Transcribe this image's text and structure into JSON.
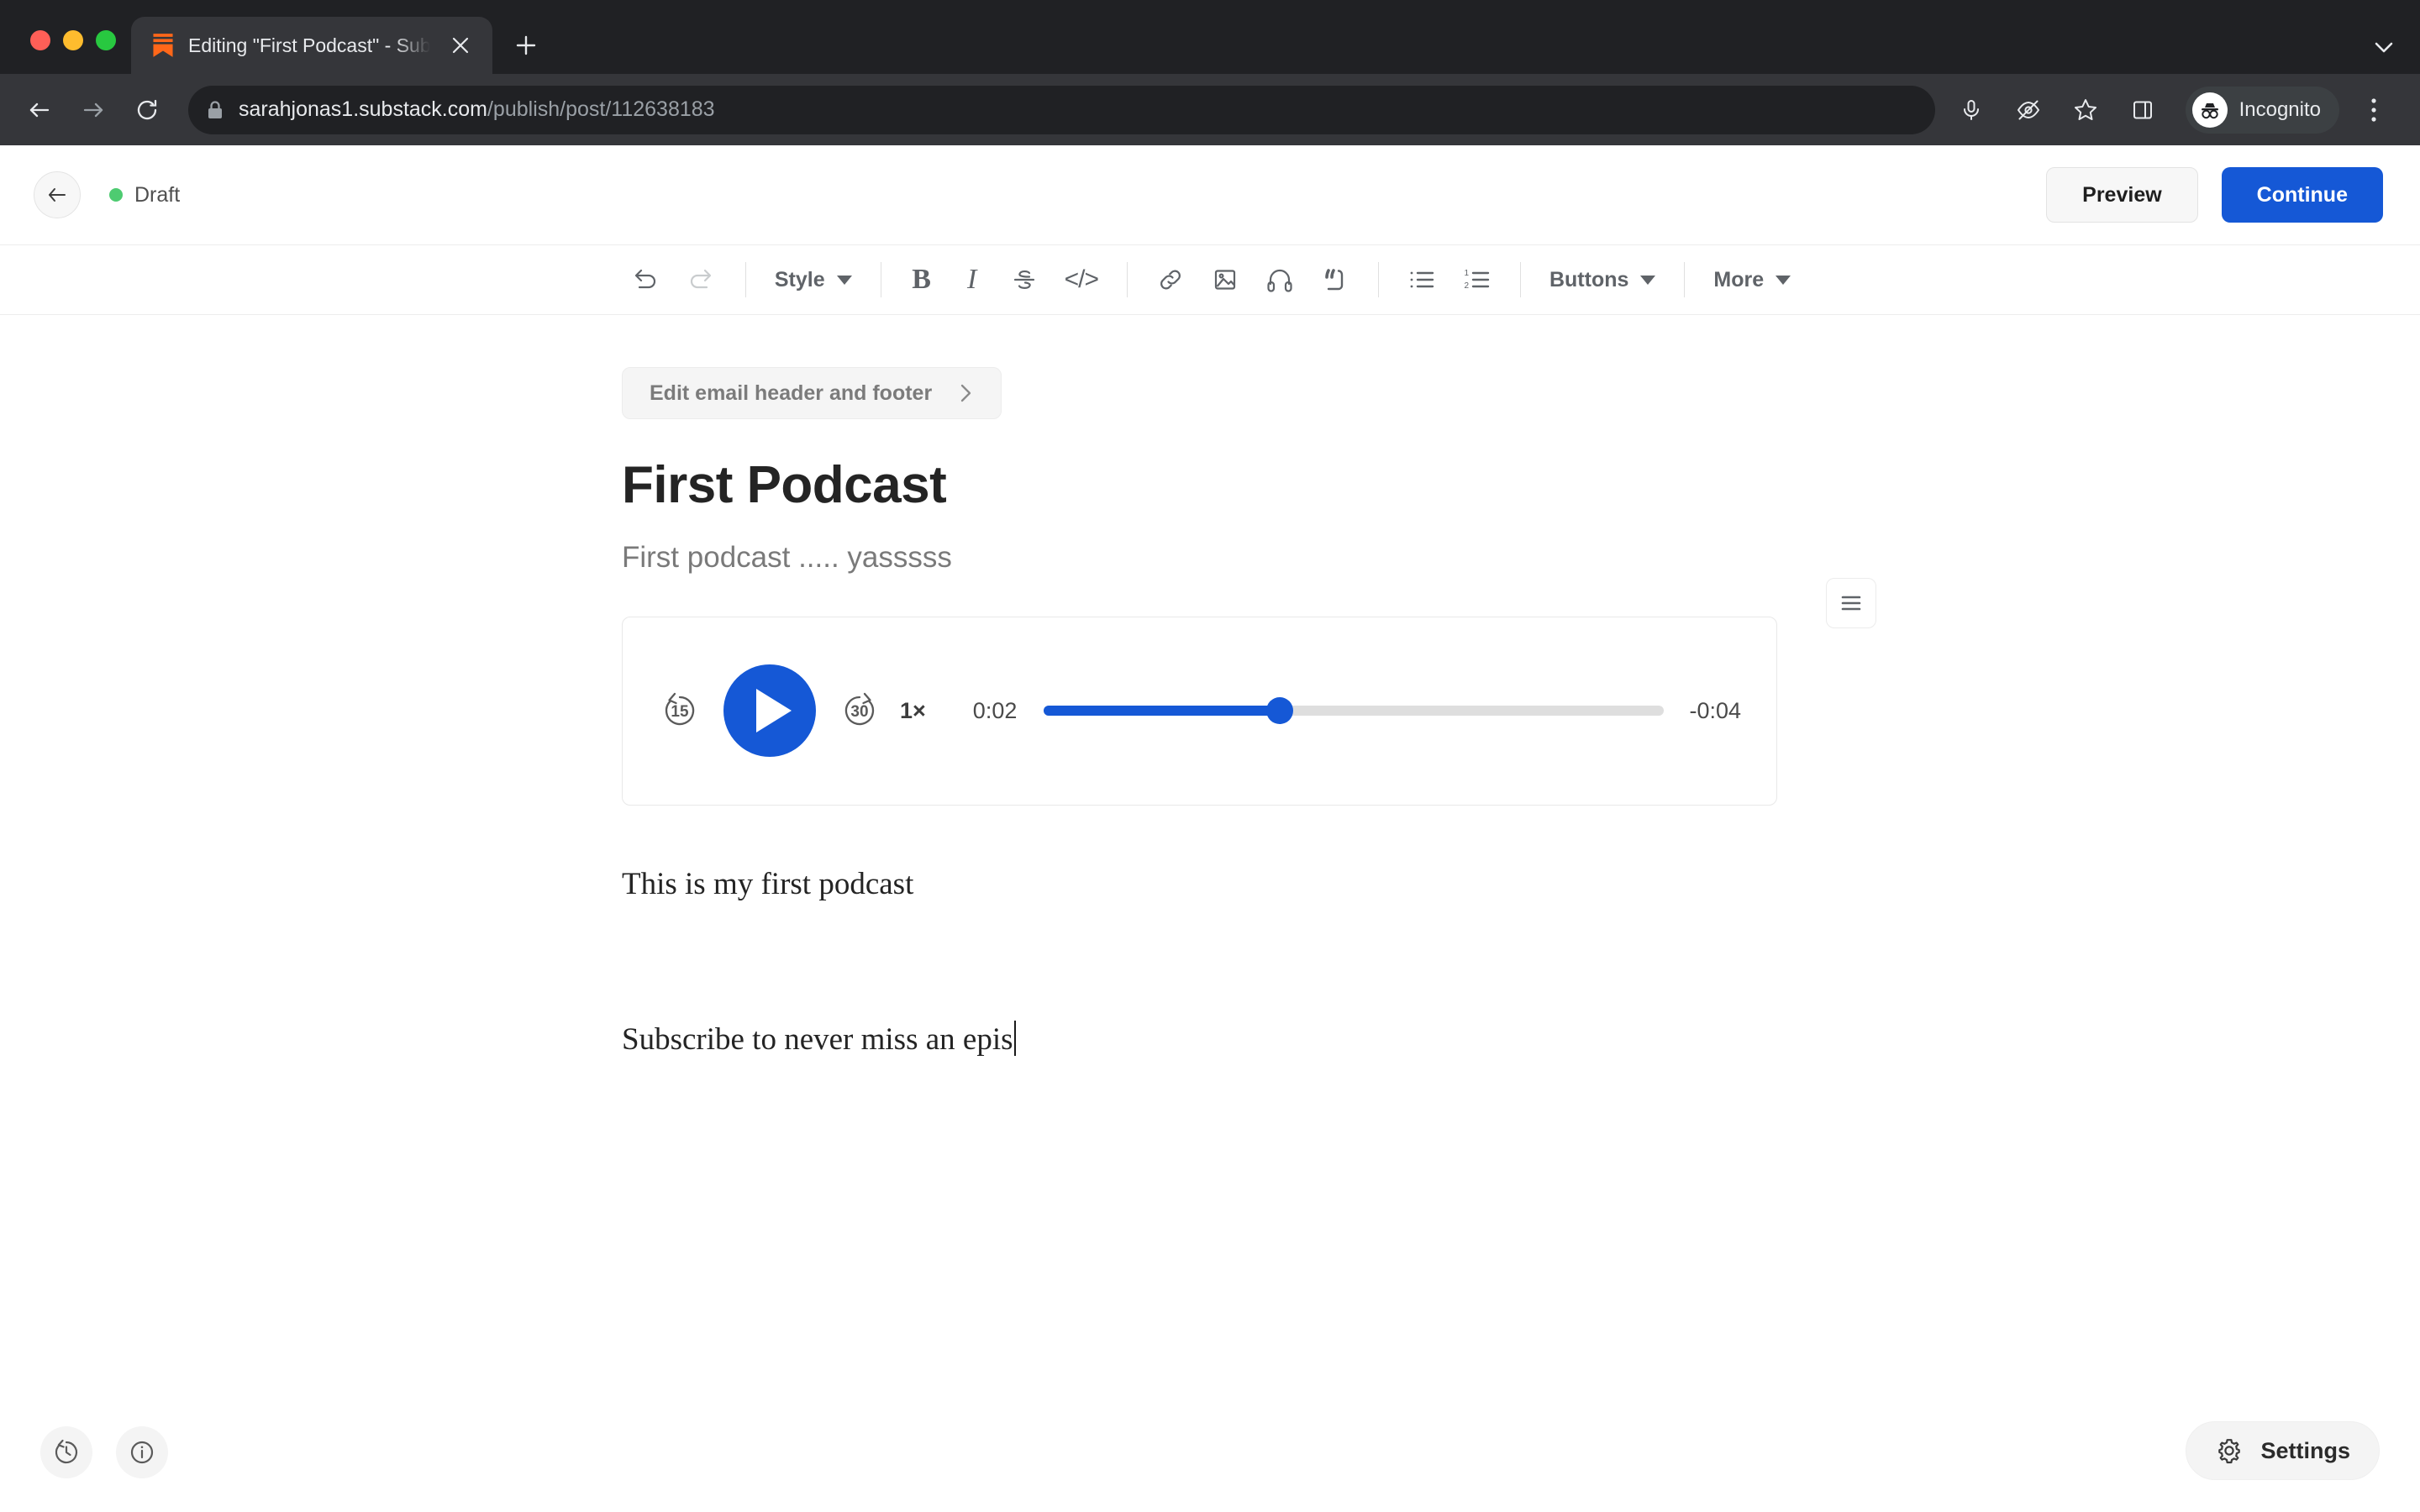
{
  "browser": {
    "tab": {
      "title": "Editing \"First Podcast\" - Subst",
      "favicon": "substack-icon",
      "close": "close-icon",
      "newtab": "new-tab-icon"
    },
    "toolbar": {
      "back": "back-arrow-icon",
      "forward": "forward-arrow-icon",
      "reload": "reload-icon",
      "lock": "lock-icon",
      "url_domain": "sarahjonas1.substack.com",
      "url_path": "/publish/post/112638183",
      "mic": "microphone-icon",
      "eye_off": "eye-off-icon",
      "bookmark": "star-icon",
      "side_panel": "side-panel-icon",
      "profile_label": "Incognito",
      "menu": "three-dots-icon",
      "tabstrip_chevron": "chevron-down-icon"
    }
  },
  "app_header": {
    "back": "back-arrow-icon",
    "status_label": "Draft",
    "status_color": "#4ecb71",
    "preview_label": "Preview",
    "continue_label": "Continue",
    "accent_color": "#1558d6"
  },
  "editor_toolbar": {
    "undo": "undo-icon",
    "redo": "redo-icon",
    "style_label": "Style",
    "bold_label": "B",
    "italic_label": "I",
    "strikethrough": "strikethrough-icon",
    "code_label": "</>",
    "link": "link-icon",
    "image": "image-icon",
    "audio": "headphones-icon",
    "quote": "blockquote-icon",
    "bullet_list": "bullet-list-icon",
    "numbered_list": "numbered-list-icon",
    "buttons_label": "Buttons",
    "more_label": "More"
  },
  "document": {
    "email_header_footer_label": "Edit email header and footer",
    "email_header_footer_chevron": "chevron-right-icon",
    "title": "First Podcast",
    "subtitle": "First podcast ..... yasssss",
    "paragraph_1": "This is my first podcast",
    "paragraph_2": "Subscribe to never miss an epis"
  },
  "audio_player": {
    "rewind_label": "15",
    "forward_label": "30",
    "play": "play-icon",
    "speed_label": "1×",
    "current_time": "0:02",
    "remaining_time": "-0:04",
    "progress_percent": 38,
    "fill_color": "#1558d6",
    "track_color": "#dedede",
    "menu": "hamburger-menu-icon"
  },
  "footer": {
    "history": "history-clock-icon",
    "info": "info-icon",
    "settings_icon": "gear-icon",
    "settings_label": "Settings"
  }
}
